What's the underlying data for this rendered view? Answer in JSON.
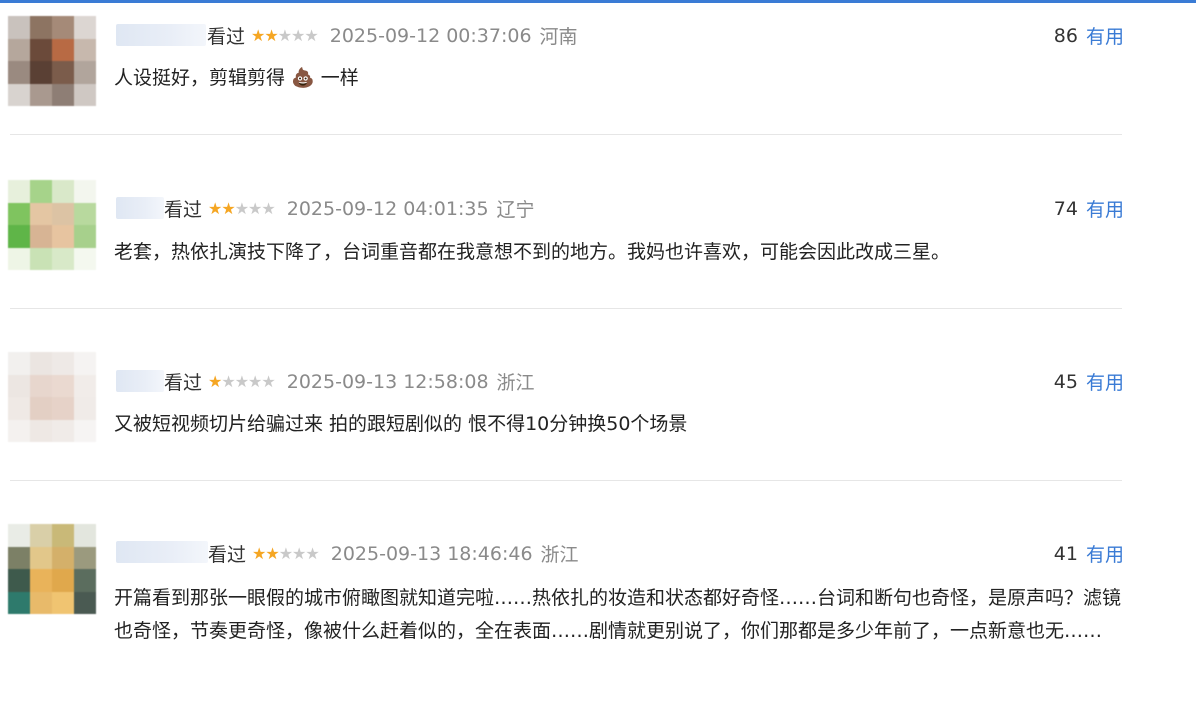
{
  "reviews": [
    {
      "watched": "看过",
      "stars": 2,
      "date": "2025-09-12 00:37:06",
      "location": "河南",
      "useful_count": "86",
      "useful_label": "有用",
      "content": "人设挺好，剪辑剪得 💩 一样",
      "avatar_colors": [
        "#c9c2bd",
        "#8d7462",
        "#a58a78",
        "#dcd6d2",
        "#b5a79c",
        "#6b4a3a",
        "#b86a44",
        "#c7b8ad",
        "#9a8a80",
        "#5a4034",
        "#7b5c4b",
        "#b1a59c",
        "#d8d3cf",
        "#a9998f",
        "#8e7e75",
        "#cfc8c3"
      ]
    },
    {
      "watched": "看过",
      "stars": 2,
      "date": "2025-09-12 04:01:35",
      "location": "辽宁",
      "useful_count": "74",
      "useful_label": "有用",
      "content": "老套，热依扎演技下降了，台词重音都在我意想不到的地方。我妈也许喜欢，可能会因此改成三星。",
      "avatar_colors": [
        "#e7f0dc",
        "#a6d38a",
        "#d9e8c9",
        "#f3f6ee",
        "#7fc45f",
        "#e4c6a3",
        "#dcc3a4",
        "#b8d99e",
        "#5fb548",
        "#d7b494",
        "#e7c4a0",
        "#a7d08c",
        "#eef5e6",
        "#c9e2b5",
        "#d8e9c8",
        "#f4f8ef"
      ]
    },
    {
      "watched": "看过",
      "stars": 1,
      "date": "2025-09-13 12:58:08",
      "location": "浙江",
      "useful_count": "45",
      "useful_label": "有用",
      "content": "又被短视频切片给骗过来 拍的跟短剧似的 恨不得10分钟换50个场景",
      "avatar_colors": [
        "#f2f0ee",
        "#ebe5e1",
        "#eee9e6",
        "#f5f3f2",
        "#ece6e2",
        "#e7d6cd",
        "#ead9d0",
        "#f1ece9",
        "#efe9e5",
        "#e3cfc4",
        "#e6d2c8",
        "#f0ebe8",
        "#f4f1ef",
        "#eee8e4",
        "#f0ebe8",
        "#f6f4f3"
      ]
    },
    {
      "watched": "看过",
      "stars": 2,
      "date": "2025-09-13 18:46:46",
      "location": "浙江",
      "useful_count": "41",
      "useful_label": "有用",
      "content": "开篇看到那张一眼假的城市俯瞰图就知道完啦……热依扎的妆造和状态都好奇怪……台词和断句也奇怪，是原声吗？滤镜也奇怪，节奏更奇怪，像被什么赶着似的，全在表面……剧情就更别说了，你们那都是多少年前了，一点新意也无……",
      "avatar_colors": [
        "#e9ece6",
        "#d9cfa8",
        "#c9b978",
        "#e3e6de",
        "#7c8066",
        "#e2c78a",
        "#d4b06a",
        "#9b9a7e",
        "#3e5a4c",
        "#e9b35a",
        "#e0a84c",
        "#5b6d5e",
        "#2e7a6c",
        "#e8ba6a",
        "#f0c471",
        "#4a5a52"
      ]
    }
  ]
}
